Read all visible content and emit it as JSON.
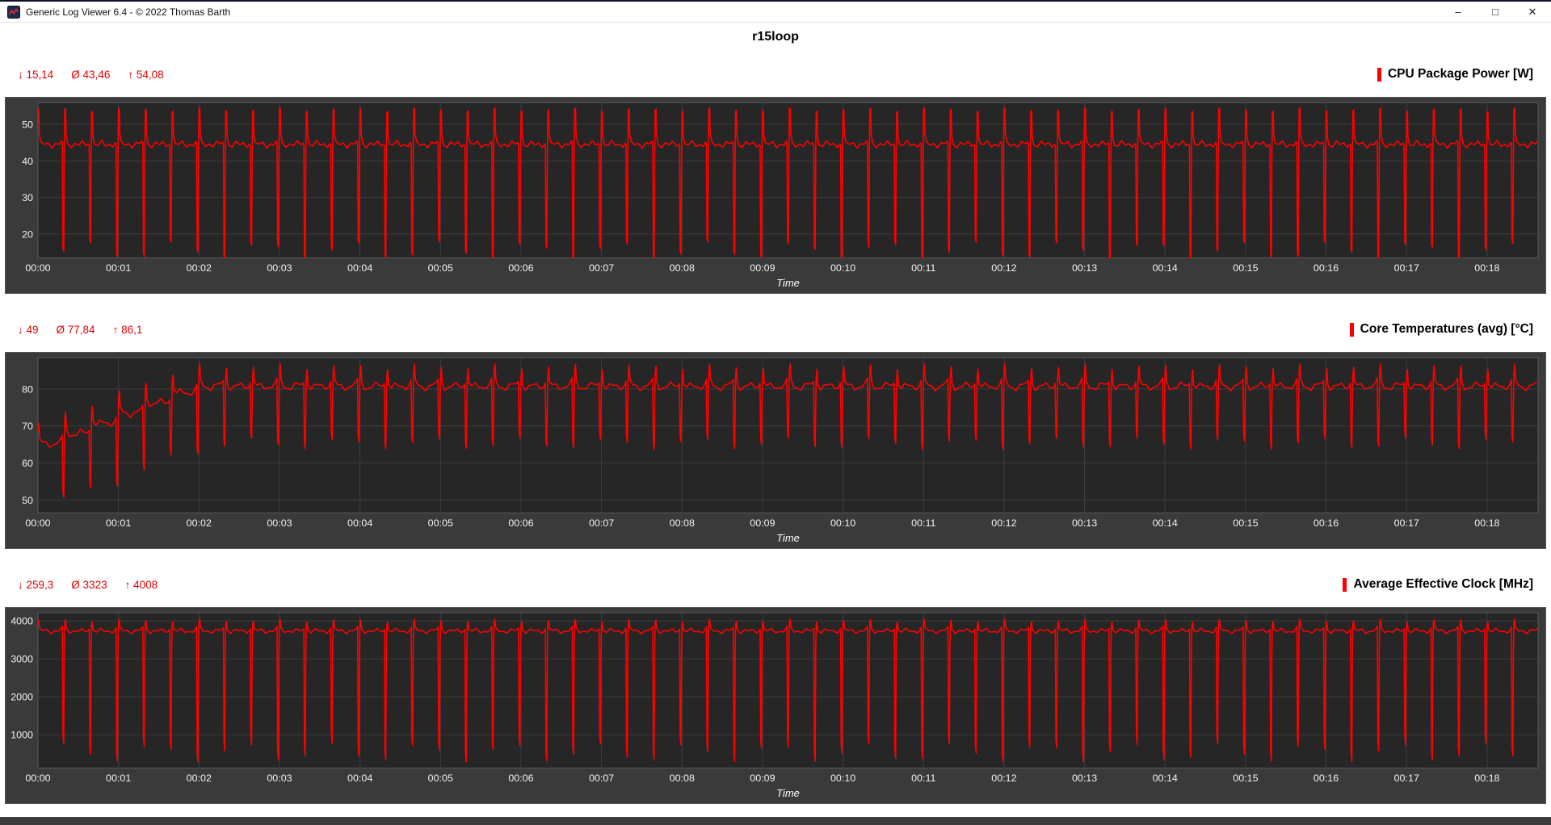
{
  "window": {
    "title": "Generic Log Viewer 6.4 - © 2022 Thomas Barth",
    "controls": {
      "minimize": "–",
      "maximize": "□",
      "close": "✕"
    }
  },
  "page_title": "r15loop",
  "time_axis_label": "Time",
  "colors": {
    "accent_red": "#e10000",
    "panel_gray": "#3a3a3a",
    "plot_bg": "#262626"
  },
  "chart_data": [
    {
      "type": "line",
      "title": "CPU Package Power [W]",
      "stats": {
        "min": "↓ 15,14",
        "avg": "Ø 43,46",
        "max": "↑ 54,08"
      },
      "summary_values": {
        "min": 15.14,
        "avg": 43.46,
        "max": 54.08
      },
      "series_color": "#ff0000",
      "xlabel": "Time",
      "ylim": [
        13.5,
        56
      ],
      "yticks": [
        20,
        30,
        40,
        50
      ],
      "xtick_labels": [
        "00:00",
        "00:01",
        "00:02",
        "00:03",
        "00:04",
        "00:05",
        "00:06",
        "00:07",
        "00:08",
        "00:09",
        "00:10",
        "00:11",
        "00:12",
        "00:13",
        "00:14",
        "00:15",
        "00:16",
        "00:17",
        "00:18"
      ],
      "xtick_interval_seconds": 60,
      "total_seconds": 1118,
      "period_seconds": 20,
      "cycle_points": [
        [
          0.0,
          53.8
        ],
        [
          0.03,
          54.0
        ],
        [
          0.05,
          47.0
        ],
        [
          0.11,
          44.8
        ],
        [
          0.24,
          44.1
        ],
        [
          0.38,
          45.1
        ],
        [
          0.52,
          44.0
        ],
        [
          0.66,
          45.0
        ],
        [
          0.79,
          44.2
        ],
        [
          0.88,
          45.0
        ],
        [
          0.91,
          44.6
        ],
        [
          0.932,
          16.2
        ],
        [
          0.962,
          15.3
        ],
        [
          0.982,
          42.0
        ]
      ],
      "dip_threshold": 30,
      "dip_jitter": 2.5,
      "plateau_jitter": 0.5
    },
    {
      "type": "line",
      "title": "Core Temperatures (avg) [°C]",
      "stats": {
        "min": "↓ 49",
        "avg": "Ø 77,84",
        "max": "↑ 86,1"
      },
      "summary_values": {
        "min": 49,
        "avg": 77.84,
        "max": 86.1
      },
      "series_color": "#ff0000",
      "xlabel": "Time",
      "ylim": [
        46.5,
        88.5
      ],
      "yticks": [
        50,
        60,
        70,
        80
      ],
      "xtick_labels": [
        "00:00",
        "00:01",
        "00:02",
        "00:03",
        "00:04",
        "00:05",
        "00:06",
        "00:07",
        "00:08",
        "00:09",
        "00:10",
        "00:11",
        "00:12",
        "00:13",
        "00:14",
        "00:15",
        "00:16",
        "00:17",
        "00:18"
      ],
      "xtick_interval_seconds": 60,
      "total_seconds": 1118,
      "period_seconds": 20,
      "cycle_points": [
        [
          0.0,
          84.0
        ],
        [
          0.03,
          86.0
        ],
        [
          0.065,
          81.8
        ],
        [
          0.16,
          80.4
        ],
        [
          0.3,
          80.9
        ],
        [
          0.44,
          80.3
        ],
        [
          0.58,
          81.1
        ],
        [
          0.72,
          80.6
        ],
        [
          0.85,
          81.3
        ],
        [
          0.905,
          82.2
        ],
        [
          0.932,
          66.8
        ],
        [
          0.962,
          65.2
        ],
        [
          0.982,
          76.0
        ]
      ],
      "ramp": {
        "offset": 15.5,
        "duration_seconds": 112
      },
      "dip_threshold": 72,
      "dip_jitter": 1.5,
      "plateau_jitter": 0.8
    },
    {
      "type": "line",
      "title": "Average Effective Clock [MHz]",
      "stats": {
        "min": "↓ 259,3",
        "avg": "Ø 3323",
        "max": "↑ 4008"
      },
      "summary_values": {
        "min": 259.3,
        "avg": 3323,
        "max": 4008
      },
      "series_color": "#ff0000",
      "xlabel": "Time",
      "ylim": [
        120,
        4220
      ],
      "yticks": [
        1000,
        2000,
        3000,
        4000
      ],
      "xtick_labels": [
        "00:00",
        "00:01",
        "00:02",
        "00:03",
        "00:04",
        "00:05",
        "00:06",
        "00:07",
        "00:08",
        "00:09",
        "00:10",
        "00:11",
        "00:12",
        "00:13",
        "00:14",
        "00:15",
        "00:16",
        "00:17",
        "00:18"
      ],
      "xtick_interval_seconds": 60,
      "total_seconds": 1118,
      "period_seconds": 20,
      "cycle_points": [
        [
          0.0,
          3930
        ],
        [
          0.025,
          4008
        ],
        [
          0.06,
          3790
        ],
        [
          0.18,
          3710
        ],
        [
          0.33,
          3770
        ],
        [
          0.48,
          3705
        ],
        [
          0.63,
          3760
        ],
        [
          0.78,
          3715
        ],
        [
          0.88,
          3780
        ],
        [
          0.91,
          3820
        ],
        [
          0.932,
          760
        ],
        [
          0.96,
          520
        ],
        [
          0.982,
          3250
        ]
      ],
      "dip_threshold": 2000,
      "dip_jitter": 240,
      "plateau_jitter": 40
    }
  ]
}
